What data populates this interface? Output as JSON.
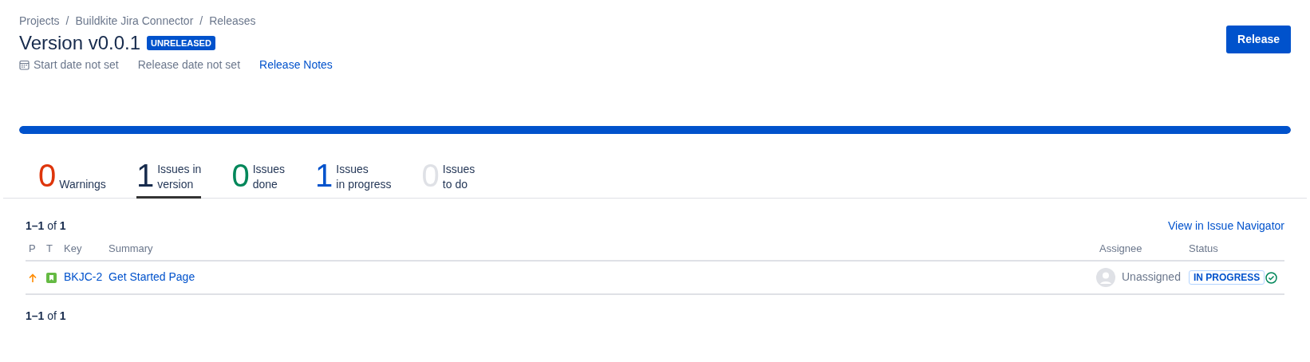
{
  "breadcrumbs": [
    "Projects",
    "Buildkite Jira Connector",
    "Releases"
  ],
  "breadcrumb_separator": "/",
  "title": "Version v0.0.1",
  "status_badge": "UNRELEASED",
  "meta": {
    "start_date": "Start date not set",
    "release_date": "Release date not set",
    "release_notes_link": "Release Notes"
  },
  "release_button": "Release",
  "progress": {
    "level": 1.0
  },
  "stats": [
    {
      "count": "0",
      "label_lines": [
        "Warnings"
      ],
      "color": "#de350b",
      "selected": false
    },
    {
      "count": "1",
      "label_lines": [
        "Issues in",
        "version"
      ],
      "color": "#172b4d",
      "selected": true
    },
    {
      "count": "0",
      "label_lines": [
        "Issues",
        "done"
      ],
      "color": "#00875a",
      "selected": false
    },
    {
      "count": "1",
      "label_lines": [
        "Issues",
        "in progress"
      ],
      "color": "#0052cc",
      "selected": false
    },
    {
      "count": "0",
      "label_lines": [
        "Issues",
        "to do"
      ],
      "color": "#dfe1e6",
      "selected": false
    }
  ],
  "pagination_top": {
    "range": "1–1",
    "of": "of",
    "total": "1"
  },
  "navigator_link": "View in Issue Navigator",
  "table": {
    "columns": [
      "P",
      "T",
      "Key",
      "Summary",
      "Assignee",
      "Status"
    ],
    "rows": [
      {
        "key": "BKJC-2",
        "summary": "Get Started Page",
        "assignee": "Unassigned",
        "status": "IN PROGRESS",
        "done_check": true
      }
    ]
  },
  "pagination_bottom": {
    "range": "1–1",
    "of": "of",
    "total": "1"
  }
}
